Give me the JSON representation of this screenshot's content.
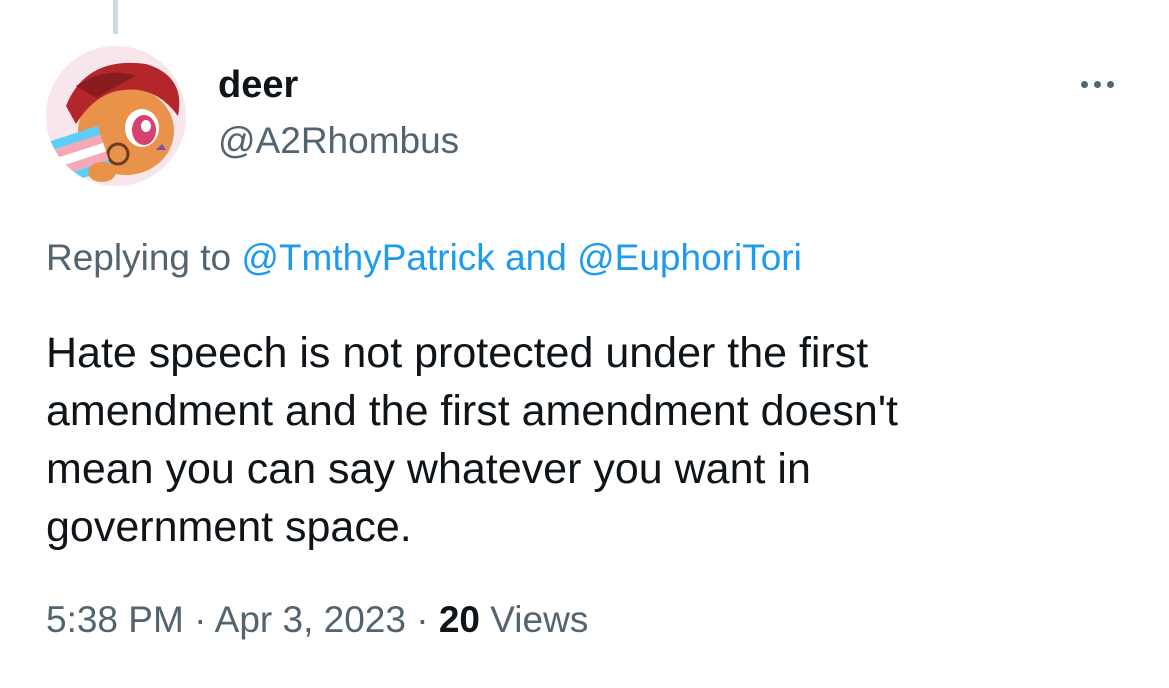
{
  "author": {
    "display_name": "deer",
    "handle": "@A2Rhombus",
    "avatar_icon": "pony-avatar-with-trans-flag"
  },
  "reply_context": {
    "prefix": "Replying to",
    "mention_1": "@TmthyPatrick",
    "conjunction": "and",
    "mention_2": "@EuphoriTori"
  },
  "tweet": {
    "lines": [
      "Hate speech is not protected under the first",
      "amendment and the first amendment doesn't",
      "mean you can say whatever you want in",
      "government space."
    ]
  },
  "meta": {
    "time": "5:38 PM",
    "separator": "·",
    "date": "Apr 3, 2023",
    "views_count": "20",
    "views_label": "Views"
  },
  "colors": {
    "link": "#1d9bf0",
    "secondary_text": "#536471",
    "primary_text": "#0f1419",
    "thread_line": "#cfd9de"
  }
}
